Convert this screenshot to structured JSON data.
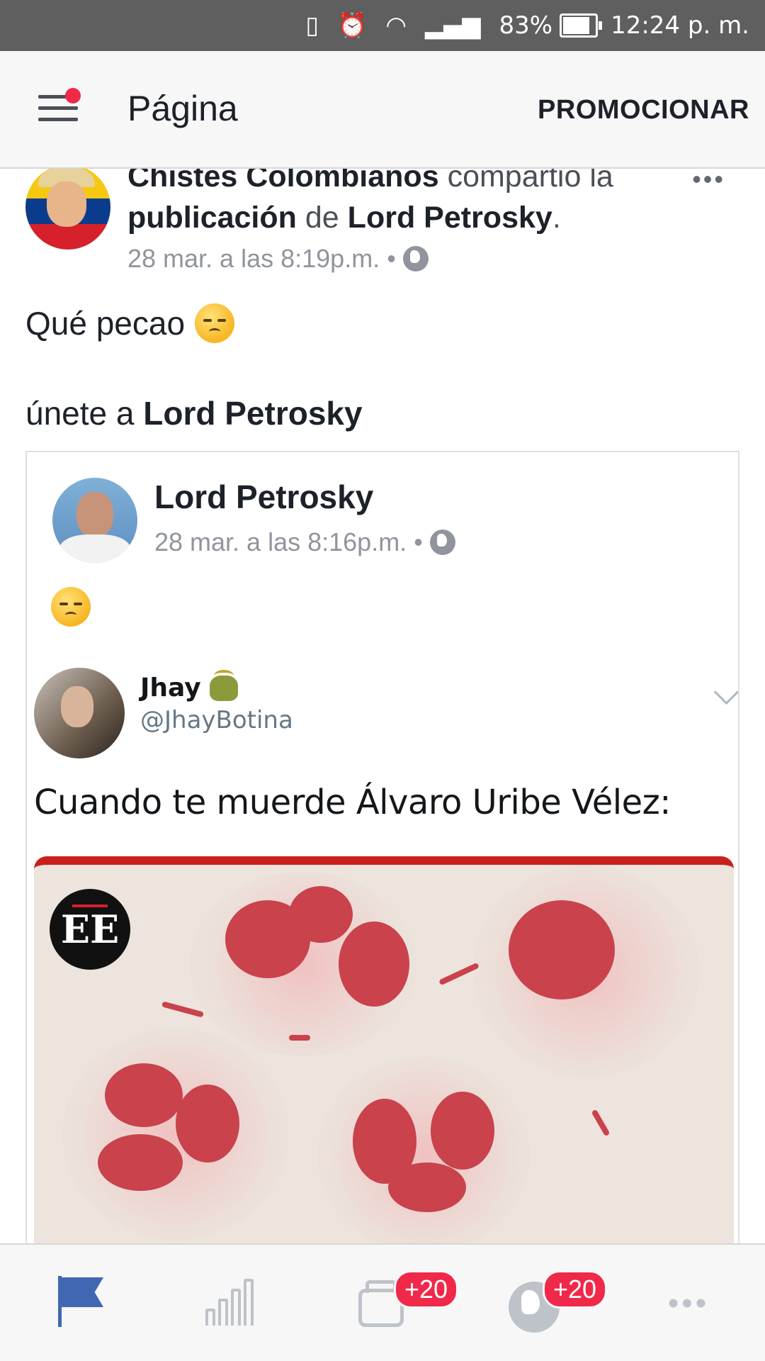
{
  "status_bar": {
    "battery": "83%",
    "battery_level": 0.83,
    "time": "12:24 p. m."
  },
  "app_bar": {
    "title": "Página",
    "promote_label": "PROMOCIONAR"
  },
  "post": {
    "page_name": "Chistes Colombianos",
    "shared_text": "compartió la",
    "publication_word": "publicación",
    "of_word": "de",
    "original_author": "Lord Petrosky",
    "period": ".",
    "timestamp": "28 mar. a las 8:19p.m. •",
    "message": "Qué pecao",
    "join_prefix": "únete a",
    "join_target": "Lord Petrosky"
  },
  "shared_card": {
    "author": "Lord Petrosky",
    "timestamp": "28 mar. a las 8:16p.m. •",
    "tweet": {
      "name": "Jhay",
      "handle": "@JhayBotina",
      "text": "Cuando te muerde Álvaro Uribe Vélez:",
      "image_logo": "EE"
    }
  },
  "bottom_nav": {
    "items": [
      {
        "icon": "flag-icon",
        "active": true
      },
      {
        "icon": "bar-chart-icon"
      },
      {
        "icon": "inbox-tray-icon",
        "badge": "+20"
      },
      {
        "icon": "globe-icon",
        "badge": "+20"
      },
      {
        "icon": "more-icon"
      }
    ]
  },
  "colors": {
    "accent": "#4267b2",
    "badge": "#f02849",
    "status_bar": "#5f5f5f"
  }
}
